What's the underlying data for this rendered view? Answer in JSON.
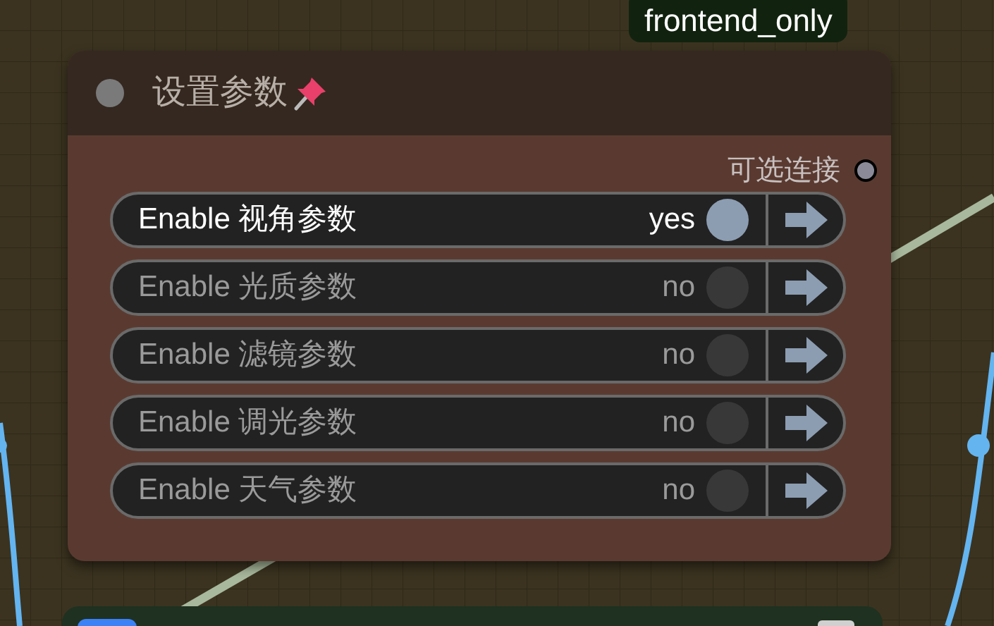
{
  "badge": {
    "label": "frontend_only"
  },
  "node": {
    "title": "设置参数",
    "output": {
      "label": "可选连接"
    },
    "toggles": [
      {
        "label": "Enable 视角参数",
        "value": "yes",
        "on": true
      },
      {
        "label": "Enable 光质参数",
        "value": "no",
        "on": false
      },
      {
        "label": "Enable 滤镜参数",
        "value": "no",
        "on": false
      },
      {
        "label": "Enable 调光参数",
        "value": "no",
        "on": false
      },
      {
        "label": "Enable 天气参数",
        "value": "no",
        "on": false
      }
    ]
  }
}
